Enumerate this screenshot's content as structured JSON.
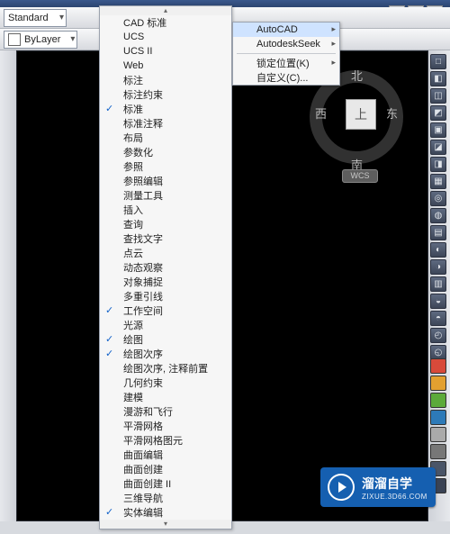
{
  "combos": {
    "standard": "Standard",
    "layer": "ByLayer"
  },
  "window_buttons": [
    "–",
    "☐",
    "×"
  ],
  "viewcube": {
    "north": "北",
    "south": "南",
    "west": "西",
    "east": "东",
    "top": "上",
    "wcs": "WCS"
  },
  "main_menu": {
    "items": [
      {
        "label": "CAD 标准",
        "checked": false
      },
      {
        "label": "UCS",
        "checked": false
      },
      {
        "label": "UCS II",
        "checked": false
      },
      {
        "label": "Web",
        "checked": false
      },
      {
        "label": "标注",
        "checked": false
      },
      {
        "label": "标注约束",
        "checked": false
      },
      {
        "label": "标准",
        "checked": true
      },
      {
        "label": "标准注释",
        "checked": false
      },
      {
        "label": "布局",
        "checked": false
      },
      {
        "label": "参数化",
        "checked": false
      },
      {
        "label": "参照",
        "checked": false
      },
      {
        "label": "参照编辑",
        "checked": false
      },
      {
        "label": "测量工具",
        "checked": false
      },
      {
        "label": "插入",
        "checked": false
      },
      {
        "label": "查询",
        "checked": false
      },
      {
        "label": "查找文字",
        "checked": false
      },
      {
        "label": "点云",
        "checked": false
      },
      {
        "label": "动态观察",
        "checked": false
      },
      {
        "label": "对象捕捉",
        "checked": false
      },
      {
        "label": "多重引线",
        "checked": false
      },
      {
        "label": "工作空间",
        "checked": true
      },
      {
        "label": "光源",
        "checked": false
      },
      {
        "label": "绘图",
        "checked": true
      },
      {
        "label": "绘图次序",
        "checked": true
      },
      {
        "label": "绘图次序, 注释前置",
        "checked": false
      },
      {
        "label": "几何约束",
        "checked": false
      },
      {
        "label": "建模",
        "checked": false
      },
      {
        "label": "漫游和飞行",
        "checked": false
      },
      {
        "label": "平滑网格",
        "checked": false
      },
      {
        "label": "平滑网格图元",
        "checked": false
      },
      {
        "label": "曲面编辑",
        "checked": false
      },
      {
        "label": "曲面创建",
        "checked": false
      },
      {
        "label": "曲面创建 II",
        "checked": false
      },
      {
        "label": "三维导航",
        "checked": false
      },
      {
        "label": "实体编辑",
        "checked": true
      }
    ]
  },
  "submenu": {
    "items": [
      {
        "label": "AutoCAD",
        "has_sub": true,
        "highlight": true
      },
      {
        "label": "AutodeskSeek",
        "has_sub": true,
        "highlight": false
      }
    ],
    "items2": [
      {
        "label": "锁定位置(K)",
        "has_sub": true
      },
      {
        "label": "自定义(C)...",
        "has_sub": false
      }
    ]
  },
  "right_icons": [
    "□",
    "◧",
    "◫",
    "◩",
    "▣",
    "◪",
    "◨",
    "▦",
    "◎",
    "◍",
    "▤",
    "◐",
    "◑",
    "▥",
    "◒",
    "◓",
    "◴",
    "◵"
  ],
  "right_icons2_colors": [
    "#d84a3a",
    "#e2a030",
    "#5caa3a",
    "#2d7ab8",
    "#aaaaaa",
    "#777777",
    "#4a5568",
    "#3a4355"
  ],
  "watermark": {
    "line1": "溜溜自学",
    "line2": "ZIXUE.3D66.COM"
  }
}
